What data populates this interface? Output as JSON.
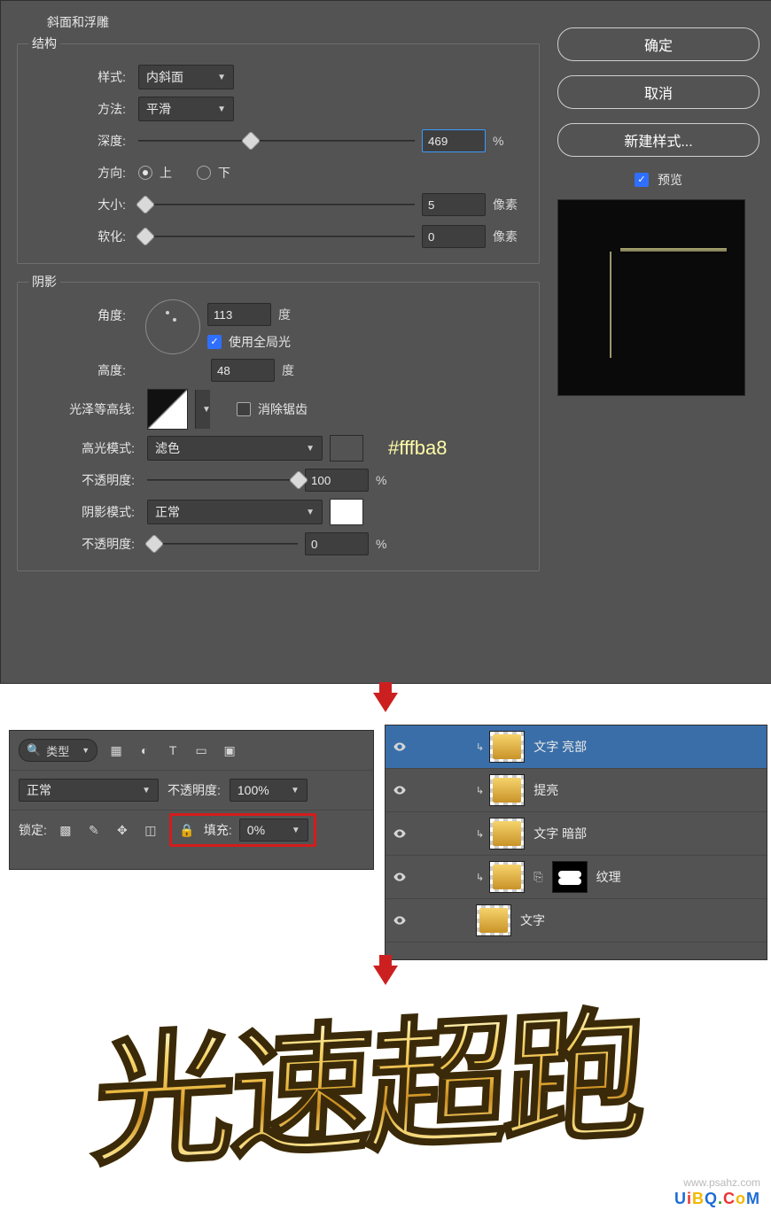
{
  "bevel": {
    "section_title": "斜面和浮雕",
    "structure_title": "结构",
    "style_label": "样式:",
    "style_value": "内斜面",
    "method_label": "方法:",
    "method_value": "平滑",
    "depth_label": "深度:",
    "depth_value": "469",
    "depth_unit": "%",
    "direction_label": "方向:",
    "direction_up": "上",
    "direction_down": "下",
    "size_label": "大小:",
    "size_value": "5",
    "size_unit": "像素",
    "soften_label": "软化:",
    "soften_value": "0",
    "soften_unit": "像素"
  },
  "shadow": {
    "section_title": "阴影",
    "angle_label": "角度:",
    "angle_value": "113",
    "angle_unit": "度",
    "global_light_label": "使用全局光",
    "altitude_label": "高度:",
    "altitude_value": "48",
    "altitude_unit": "度",
    "gloss_label": "光泽等高线:",
    "antialias_label": "消除锯齿",
    "highlight_mode_label": "高光模式:",
    "highlight_mode_value": "滤色",
    "highlight_color": "#fffba8",
    "highlight_hex_label": "#fffba8",
    "highlight_opacity_label": "不透明度:",
    "highlight_opacity_value": "100",
    "highlight_opacity_unit": "%",
    "shadow_mode_label": "阴影模式:",
    "shadow_mode_value": "正常",
    "shadow_color": "#ffffff",
    "shadow_opacity_label": "不透明度:",
    "shadow_opacity_value": "0",
    "shadow_opacity_unit": "%"
  },
  "side": {
    "ok": "确定",
    "cancel": "取消",
    "new_style": "新建样式...",
    "preview": "预览"
  },
  "panel_a": {
    "kind_label": "类型",
    "blend_label": "正常",
    "opacity_label": "不透明度:",
    "opacity_value": "100%",
    "lock_label": "锁定:",
    "fill_label": "填充:",
    "fill_value": "0%"
  },
  "panel_b": {
    "layers": [
      {
        "name": "文字 亮部",
        "active": true,
        "clip": true,
        "mask": false
      },
      {
        "name": "提亮",
        "active": false,
        "clip": true,
        "mask": false
      },
      {
        "name": "文字 暗部",
        "active": false,
        "clip": true,
        "mask": false
      },
      {
        "name": "纹理",
        "active": false,
        "clip": true,
        "mask": true
      },
      {
        "name": "文字",
        "active": false,
        "clip": false,
        "mask": false
      }
    ]
  },
  "result": {
    "text": "光速超跑",
    "watermark_small": "www.psahz.com",
    "wm_parts": [
      "U",
      "i",
      "B",
      "Q",
      ".",
      "C",
      "o",
      "M"
    ]
  }
}
